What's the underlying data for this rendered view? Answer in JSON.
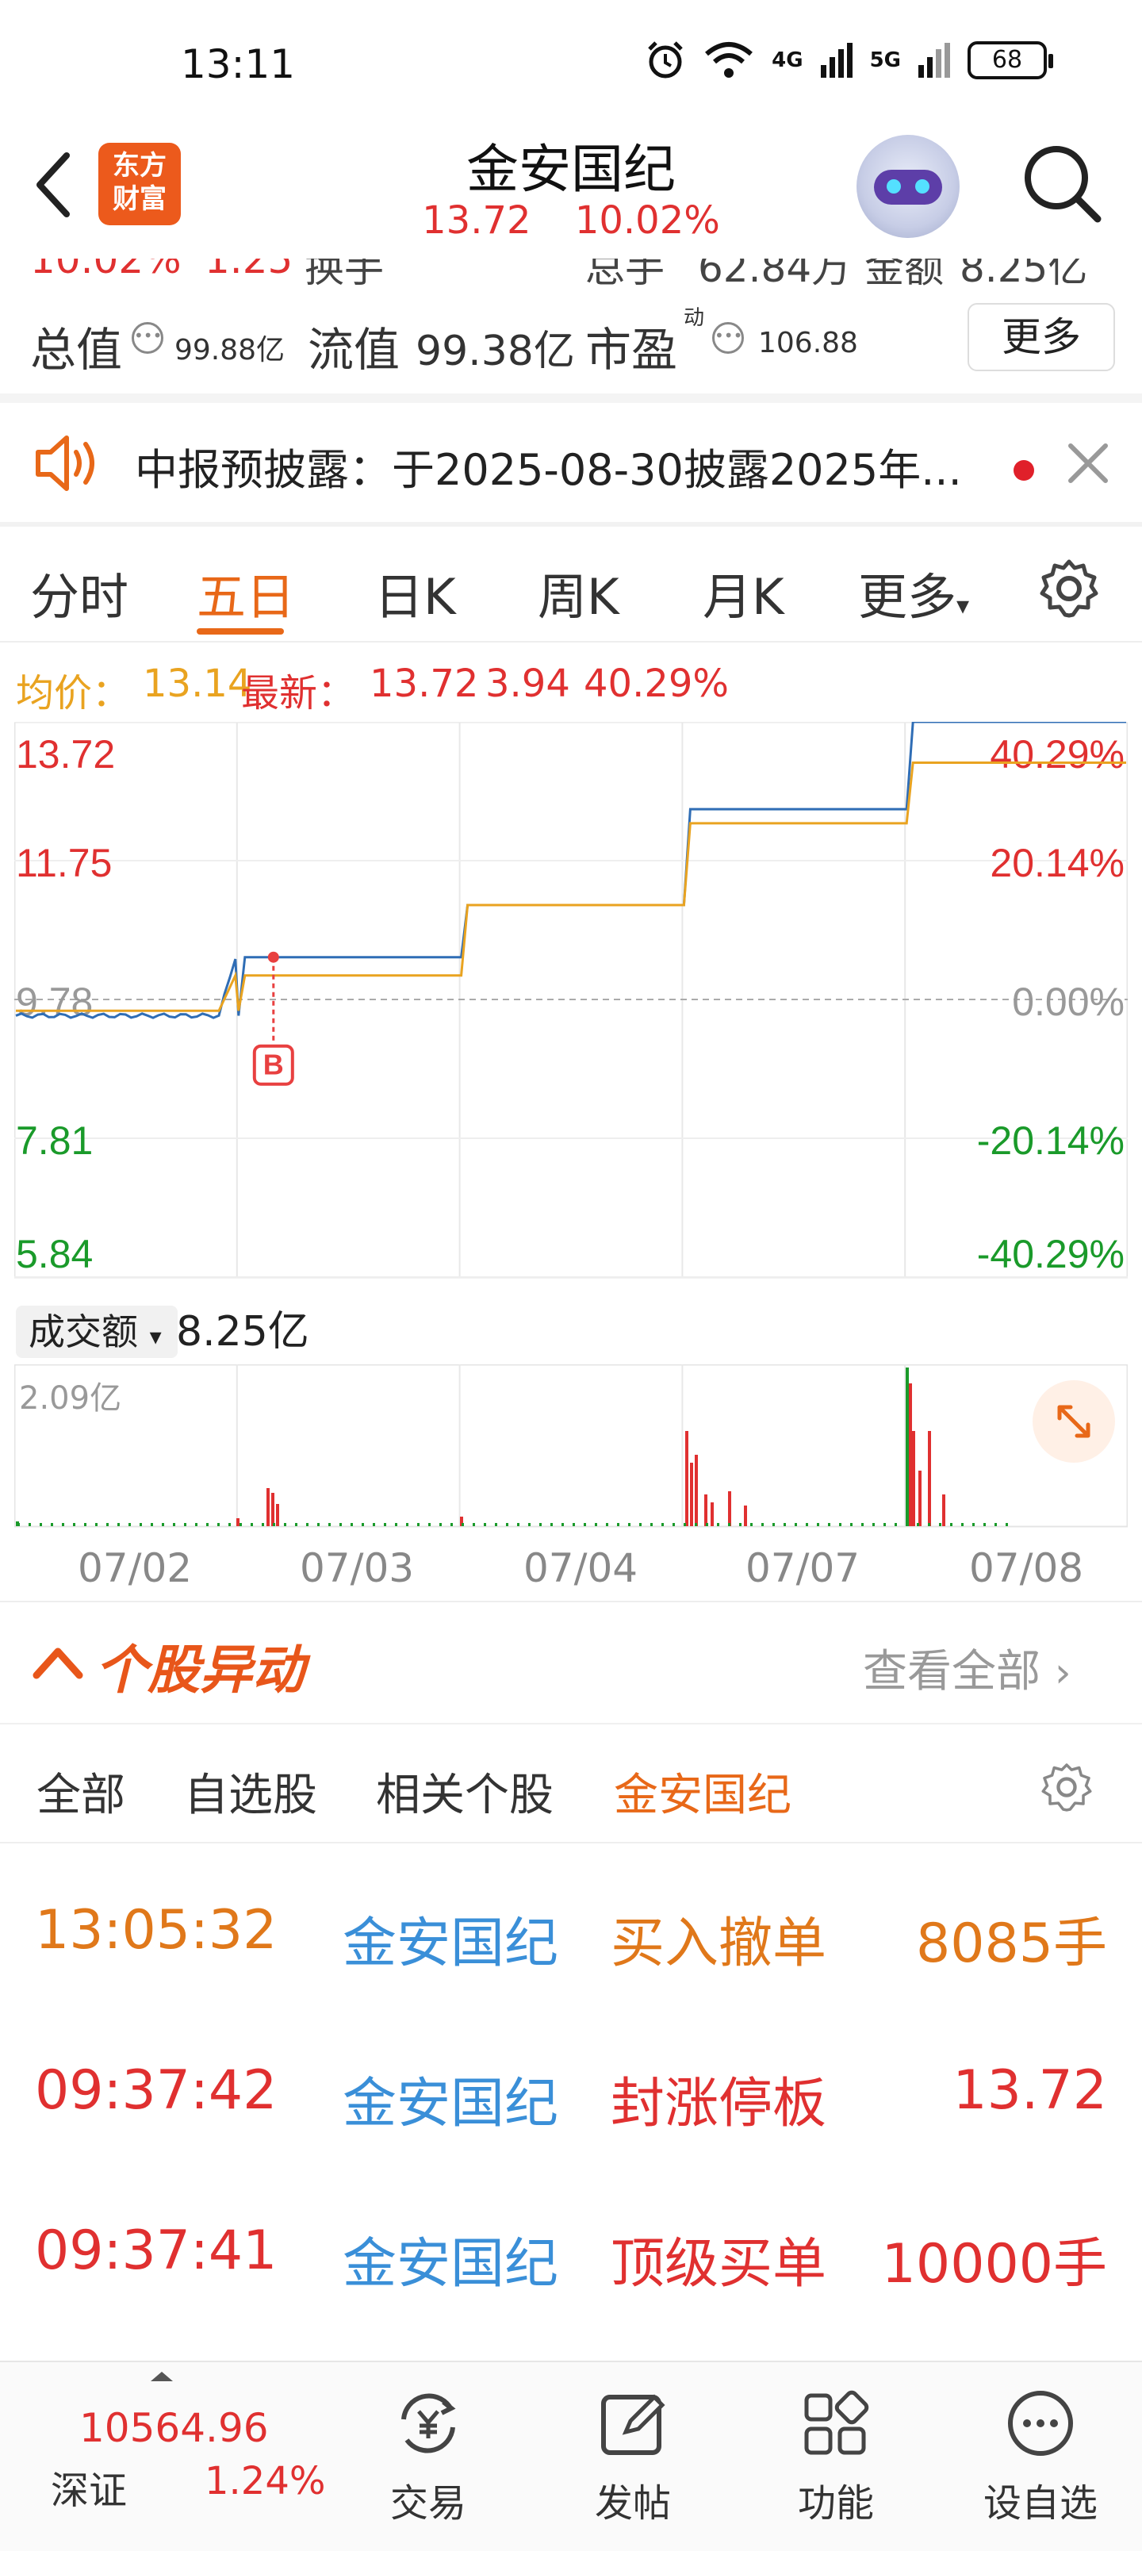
{
  "status_bar": {
    "time": "13:11",
    "network1": "4G",
    "network2": "5G",
    "battery": "68"
  },
  "header": {
    "logo_line1": "东方",
    "logo_line2": "财富",
    "title": "金安国纪",
    "price": "13.72",
    "change_pct": "10.02%"
  },
  "cut_row": {
    "a": "10.02%",
    "b": "1.25",
    "c": "换手",
    "d": "总手",
    "e": "62.84万",
    "f": "金额",
    "g": "8.25亿"
  },
  "info": {
    "total_value_label": "总值",
    "total_value": "99.88亿",
    "float_value_label": "流值",
    "float_value": "99.38亿",
    "pe_label": "市盈",
    "pe_sup": "动",
    "pe_value": "106.88",
    "more_button": "更多"
  },
  "notice": {
    "text": "中报预披露：于2025-08-30披露2025年..."
  },
  "chart_tabs": {
    "items": [
      "分时",
      "五日",
      "日K",
      "周K",
      "月K",
      "更多"
    ],
    "active": "五日"
  },
  "legend": {
    "avg_label": "均价：",
    "avg_value": "13.14",
    "latest_label": "最新：",
    "latest_value": "13.72",
    "change": "3.94",
    "change_pct": "40.29%"
  },
  "chart_data": {
    "type": "line",
    "x": [
      "07/02",
      "07/03",
      "07/04",
      "07/07",
      "07/08"
    ],
    "series": [
      {
        "name": "price",
        "color": "#2f6db5",
        "values": [
          9.55,
          10.38,
          11.12,
          12.48,
          13.72
        ]
      },
      {
        "name": "avg",
        "color": "#e9a320",
        "values": [
          9.62,
          10.12,
          11.12,
          12.28,
          13.14
        ]
      }
    ],
    "ylim": [
      5.84,
      13.72
    ],
    "prev_close": 9.78,
    "y_ticks_left": [
      "13.72",
      "11.75",
      "9.78",
      "7.81",
      "5.84"
    ],
    "y_ticks_right": [
      "40.29%",
      "20.14%",
      "0.00%",
      "-20.14%",
      "-40.29%"
    ],
    "marker_label": "B",
    "grid": true
  },
  "volume": {
    "selector": "成交额",
    "total": "8.25亿",
    "max_label": "2.09亿"
  },
  "stock_moves": {
    "title": "个股异动",
    "view_all": "查看全部"
  },
  "filters": {
    "items": [
      "全部",
      "自选股",
      "相关个股",
      "金安国纪"
    ],
    "active": "金安国纪"
  },
  "rows": [
    {
      "time": "13:05:32",
      "name": "金安国纪",
      "event": "买入撤单",
      "value": "8085手",
      "color": "#e0781a"
    },
    {
      "time": "09:37:42",
      "name": "金安国纪",
      "event": "封涨停板",
      "value": "13.72",
      "color": "#e03030"
    },
    {
      "time": "09:37:41",
      "name": "金安国纪",
      "event": "顶级买单",
      "value": "10000手",
      "color": "#e03030"
    }
  ],
  "bottom_nav": {
    "index_value": "10564.96",
    "index_name": "深证",
    "index_pct": "1.24%",
    "items": [
      {
        "label": "交易",
        "icon": "trade-icon"
      },
      {
        "label": "发帖",
        "icon": "post-icon"
      },
      {
        "label": "功能",
        "icon": "apps-icon"
      },
      {
        "label": "设自选",
        "icon": "more-icon"
      }
    ]
  }
}
